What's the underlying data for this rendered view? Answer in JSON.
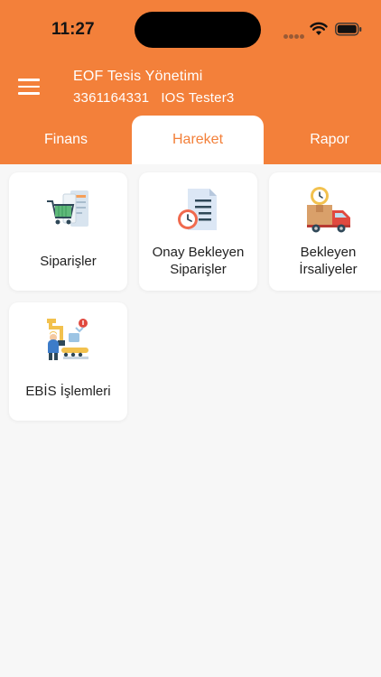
{
  "status_bar": {
    "time": "11:27"
  },
  "header": {
    "title": "EOF Tesis Yönetimi",
    "phone": "3361164331",
    "user": "IOS Tester3"
  },
  "tabs": [
    {
      "label": "Finans",
      "active": false
    },
    {
      "label": "Hareket",
      "active": true
    },
    {
      "label": "Rapor",
      "active": false
    }
  ],
  "cards": [
    {
      "label": "Siparişler",
      "icon": "shopping-cart-icon"
    },
    {
      "label": "Onay Bekleyen\nSiparişler",
      "icon": "pending-document-clock-icon"
    },
    {
      "label": "Bekleyen\nİrsaliyeler",
      "icon": "delivery-truck-clock-icon"
    },
    {
      "label": "EBİS İşlemleri",
      "icon": "factory-worker-icon"
    }
  ],
  "colors": {
    "accent": "#f3803a",
    "background": "#f7f7f7"
  }
}
